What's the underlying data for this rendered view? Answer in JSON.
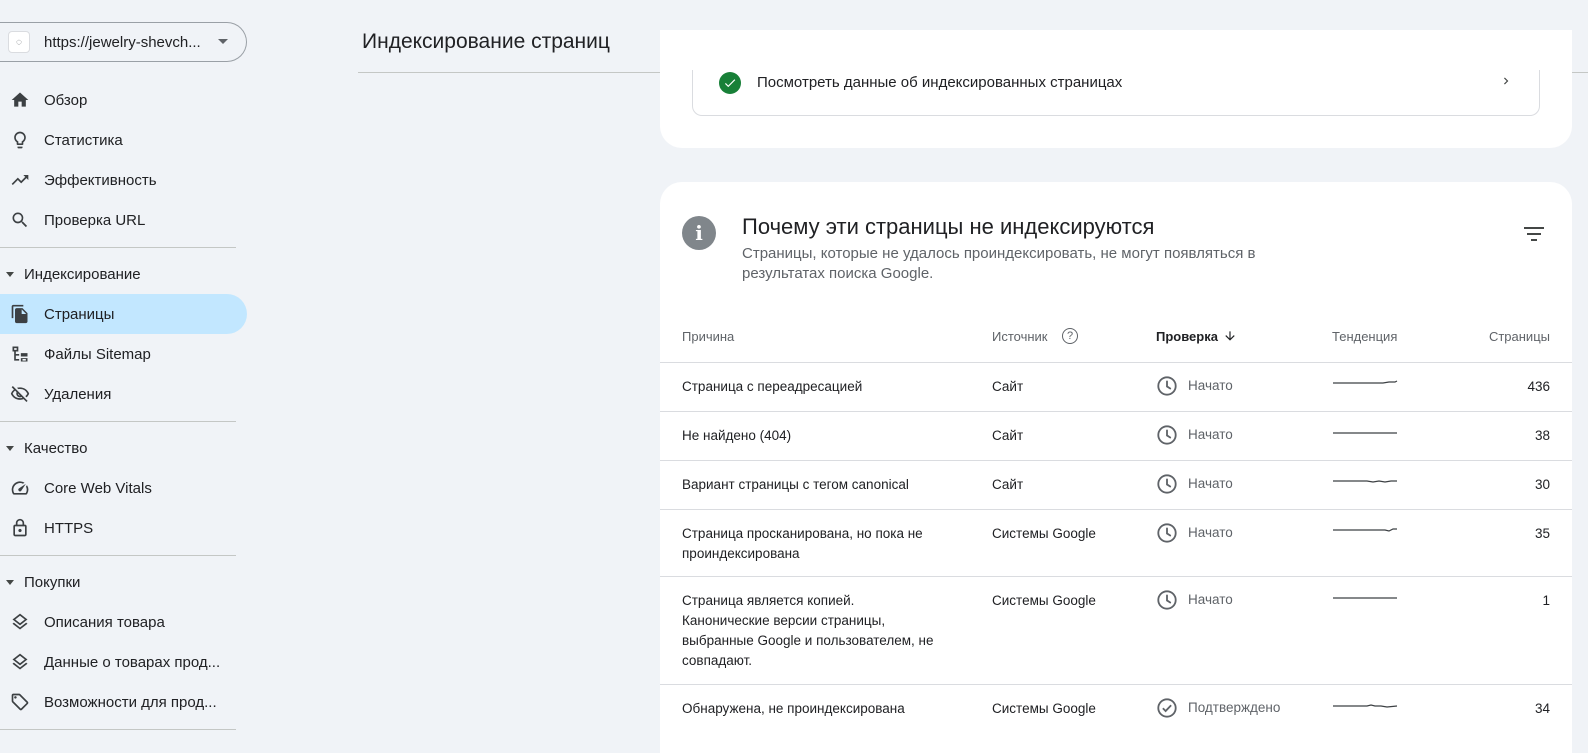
{
  "property": {
    "url": "https://jewelry-shevch...",
    "icon": "site-favicon"
  },
  "nav": {
    "overview": "Обзор",
    "stats": "Статистика",
    "performance": "Эффективность",
    "url_inspection": "Проверка URL",
    "section_indexing": "Индексирование",
    "pages": "Страницы",
    "sitemaps": "Файлы Sitemap",
    "removals": "Удаления",
    "section_quality": "Качество",
    "cwv": "Core Web Vitals",
    "https": "HTTPS",
    "section_shopping": "Покупки",
    "product_snippets": "Описания товара",
    "merchant_listings": "Данные о товарах прод...",
    "shopping_tab": "Возможности для прод..."
  },
  "header": {
    "title": "Индексирование страниц"
  },
  "top_card": {
    "view_indexed": "Посмотреть данные об индексированных страницах"
  },
  "card": {
    "title": "Почему эти страницы не индексируются",
    "subtitle": "Страницы, которые не удалось проиндексировать, не могут появляться в результатах поиска Google."
  },
  "table": {
    "headers": {
      "reason": "Причина",
      "source": "Источник",
      "validation": "Проверка",
      "trend": "Тенденция",
      "pages": "Страницы"
    },
    "rows": [
      {
        "reason": "Страница с переадресацией",
        "source": "Сайт",
        "status": "Начато",
        "status_icon": "clock-icon",
        "count": "436"
      },
      {
        "reason": "Не найдено (404)",
        "source": "Сайт",
        "status": "Начато",
        "status_icon": "clock-icon",
        "count": "38"
      },
      {
        "reason": "Вариант страницы с тегом canonical",
        "source": "Сайт",
        "status": "Начато",
        "status_icon": "clock-icon",
        "count": "30"
      },
      {
        "reason": "Страница просканирована, но пока не проиндексирована",
        "source": "Системы Google",
        "status": "Начато",
        "status_icon": "clock-icon",
        "count": "35"
      },
      {
        "reason": "Страница является копией. Канонические версии страницы, выбранные Google и пользователем, не совпадают.",
        "source": "Системы Google",
        "status": "Начато",
        "status_icon": "clock-icon",
        "count": "1"
      },
      {
        "reason": "Обнаружена, не проиндексирована",
        "source": "Системы Google",
        "status": "Подтверждено",
        "status_icon": "check-circle-icon",
        "count": "34"
      }
    ]
  },
  "colors": {
    "accent_active": "#c2e7ff",
    "success": "#188038",
    "background": "#f0f3f7"
  }
}
